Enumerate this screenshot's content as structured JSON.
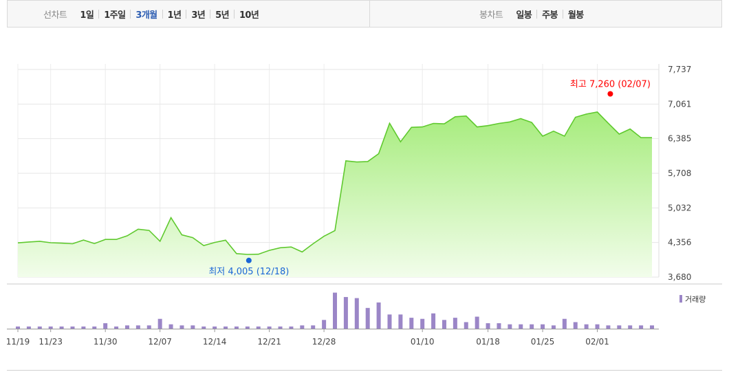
{
  "toolbar": {
    "line_label": "선차트",
    "line_options": [
      "1일",
      "1주일",
      "3개월",
      "1년",
      "3년",
      "5년",
      "10년"
    ],
    "line_active": "3개월",
    "candle_label": "봉차트",
    "candle_options": [
      "일봉",
      "주봉",
      "월봉"
    ]
  },
  "colors": {
    "line": "#5fc92e",
    "area_top": "#a6ec7c",
    "area_bottom": "#f2fdeb",
    "volume": "#9b86c7",
    "high": "#ff0000",
    "low": "#1a66d6",
    "active_tab": "#2f5fb3"
  },
  "chart_data": [
    {
      "type": "area",
      "name": "price",
      "x_ticks": [
        "11/19",
        "11/23",
        "11/30",
        "12/07",
        "12/14",
        "12/21",
        "12/28",
        "01/10",
        "01/18",
        "01/25",
        "02/01"
      ],
      "y_ticks": [
        "7,737",
        "7,061",
        "6,385",
        "5,708",
        "5,032",
        "4,356",
        "3,680"
      ],
      "ylim": [
        3680,
        7737
      ],
      "grid": true,
      "values": [
        4349,
        4367,
        4380,
        4352,
        4344,
        4331,
        4404,
        4335,
        4416,
        4416,
        4488,
        4616,
        4592,
        4380,
        4842,
        4506,
        4451,
        4296,
        4357,
        4402,
        4139,
        4123,
        4128,
        4203,
        4253,
        4268,
        4172,
        4332,
        4478,
        4590,
        5951,
        5929,
        5938,
        6091,
        6686,
        6324,
        6606,
        6614,
        6683,
        6674,
        6813,
        6827,
        6614,
        6639,
        6683,
        6712,
        6776,
        6701,
        6434,
        6532,
        6434,
        6803,
        6865,
        6906,
        6687,
        6474,
        6573,
        6405,
        6405
      ],
      "high": {
        "label": "최고 7,260 (02/07)",
        "value": 7260
      },
      "low": {
        "label": "최저 4,005 (12/18)",
        "value": 4005
      }
    },
    {
      "type": "bar",
      "name": "volume",
      "legend": "거래량",
      "values": [
        2,
        2,
        2,
        2,
        2,
        2,
        2,
        2,
        5,
        2,
        3,
        3,
        3,
        9,
        4,
        3,
        3,
        2,
        2,
        2,
        2,
        2,
        2,
        2,
        2,
        2,
        3,
        3,
        8,
        33,
        29,
        28,
        19,
        24,
        13,
        13,
        10,
        9,
        14,
        8,
        10,
        6,
        11,
        5,
        5,
        4,
        4,
        4,
        4,
        3,
        9,
        6,
        4,
        4,
        3,
        3,
        3,
        3,
        3
      ],
      "ylim": [
        0,
        34
      ]
    }
  ]
}
